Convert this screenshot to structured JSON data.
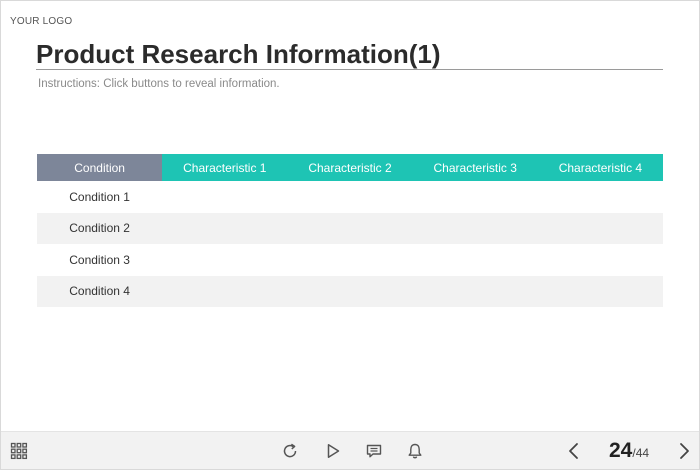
{
  "header": {
    "logo": "YOUR LOGO",
    "title": "Product Research Information(1)",
    "instructions": "Instructions: Click buttons to reveal information."
  },
  "table": {
    "columns": [
      "Condition",
      "Characteristic 1",
      "Characteristic 2",
      "Characteristic 3",
      "Characteristic 4"
    ],
    "rows": [
      {
        "condition": "Condition 1"
      },
      {
        "condition": "Condition 2"
      },
      {
        "condition": "Condition 3"
      },
      {
        "condition": "Condition 4"
      }
    ]
  },
  "footer": {
    "icons": [
      "menu-grid-icon",
      "replay-icon",
      "play-icon",
      "comment-icon",
      "bell-icon",
      "chevron-left-icon",
      "chevron-right-icon"
    ],
    "page_current": "24",
    "page_separator": "/",
    "page_total": "44"
  },
  "colors": {
    "accent": "#1ec4b4",
    "header_condition": "#7d8699",
    "row_alt": "#f2f2f2"
  }
}
